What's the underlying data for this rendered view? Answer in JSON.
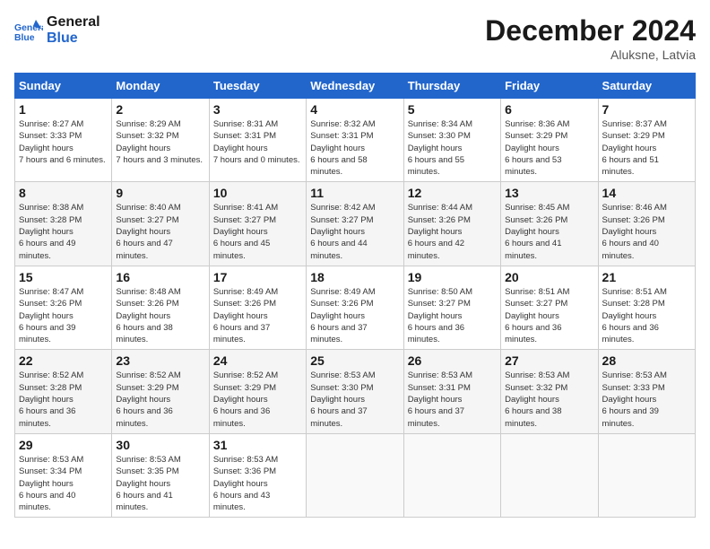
{
  "header": {
    "logo_line1": "General",
    "logo_line2": "Blue",
    "month": "December 2024",
    "location": "Aluksne, Latvia"
  },
  "days_of_week": [
    "Sunday",
    "Monday",
    "Tuesday",
    "Wednesday",
    "Thursday",
    "Friday",
    "Saturday"
  ],
  "weeks": [
    [
      {
        "day": 1,
        "sunrise": "8:27 AM",
        "sunset": "3:33 PM",
        "daylight": "7 hours and 6 minutes."
      },
      {
        "day": 2,
        "sunrise": "8:29 AM",
        "sunset": "3:32 PM",
        "daylight": "7 hours and 3 minutes."
      },
      {
        "day": 3,
        "sunrise": "8:31 AM",
        "sunset": "3:31 PM",
        "daylight": "7 hours and 0 minutes."
      },
      {
        "day": 4,
        "sunrise": "8:32 AM",
        "sunset": "3:31 PM",
        "daylight": "6 hours and 58 minutes."
      },
      {
        "day": 5,
        "sunrise": "8:34 AM",
        "sunset": "3:30 PM",
        "daylight": "6 hours and 55 minutes."
      },
      {
        "day": 6,
        "sunrise": "8:36 AM",
        "sunset": "3:29 PM",
        "daylight": "6 hours and 53 minutes."
      },
      {
        "day": 7,
        "sunrise": "8:37 AM",
        "sunset": "3:29 PM",
        "daylight": "6 hours and 51 minutes."
      }
    ],
    [
      {
        "day": 8,
        "sunrise": "8:38 AM",
        "sunset": "3:28 PM",
        "daylight": "6 hours and 49 minutes."
      },
      {
        "day": 9,
        "sunrise": "8:40 AM",
        "sunset": "3:27 PM",
        "daylight": "6 hours and 47 minutes."
      },
      {
        "day": 10,
        "sunrise": "8:41 AM",
        "sunset": "3:27 PM",
        "daylight": "6 hours and 45 minutes."
      },
      {
        "day": 11,
        "sunrise": "8:42 AM",
        "sunset": "3:27 PM",
        "daylight": "6 hours and 44 minutes."
      },
      {
        "day": 12,
        "sunrise": "8:44 AM",
        "sunset": "3:26 PM",
        "daylight": "6 hours and 42 minutes."
      },
      {
        "day": 13,
        "sunrise": "8:45 AM",
        "sunset": "3:26 PM",
        "daylight": "6 hours and 41 minutes."
      },
      {
        "day": 14,
        "sunrise": "8:46 AM",
        "sunset": "3:26 PM",
        "daylight": "6 hours and 40 minutes."
      }
    ],
    [
      {
        "day": 15,
        "sunrise": "8:47 AM",
        "sunset": "3:26 PM",
        "daylight": "6 hours and 39 minutes."
      },
      {
        "day": 16,
        "sunrise": "8:48 AM",
        "sunset": "3:26 PM",
        "daylight": "6 hours and 38 minutes."
      },
      {
        "day": 17,
        "sunrise": "8:49 AM",
        "sunset": "3:26 PM",
        "daylight": "6 hours and 37 minutes."
      },
      {
        "day": 18,
        "sunrise": "8:49 AM",
        "sunset": "3:26 PM",
        "daylight": "6 hours and 37 minutes."
      },
      {
        "day": 19,
        "sunrise": "8:50 AM",
        "sunset": "3:27 PM",
        "daylight": "6 hours and 36 minutes."
      },
      {
        "day": 20,
        "sunrise": "8:51 AM",
        "sunset": "3:27 PM",
        "daylight": "6 hours and 36 minutes."
      },
      {
        "day": 21,
        "sunrise": "8:51 AM",
        "sunset": "3:28 PM",
        "daylight": "6 hours and 36 minutes."
      }
    ],
    [
      {
        "day": 22,
        "sunrise": "8:52 AM",
        "sunset": "3:28 PM",
        "daylight": "6 hours and 36 minutes."
      },
      {
        "day": 23,
        "sunrise": "8:52 AM",
        "sunset": "3:29 PM",
        "daylight": "6 hours and 36 minutes."
      },
      {
        "day": 24,
        "sunrise": "8:52 AM",
        "sunset": "3:29 PM",
        "daylight": "6 hours and 36 minutes."
      },
      {
        "day": 25,
        "sunrise": "8:53 AM",
        "sunset": "3:30 PM",
        "daylight": "6 hours and 37 minutes."
      },
      {
        "day": 26,
        "sunrise": "8:53 AM",
        "sunset": "3:31 PM",
        "daylight": "6 hours and 37 minutes."
      },
      {
        "day": 27,
        "sunrise": "8:53 AM",
        "sunset": "3:32 PM",
        "daylight": "6 hours and 38 minutes."
      },
      {
        "day": 28,
        "sunrise": "8:53 AM",
        "sunset": "3:33 PM",
        "daylight": "6 hours and 39 minutes."
      }
    ],
    [
      {
        "day": 29,
        "sunrise": "8:53 AM",
        "sunset": "3:34 PM",
        "daylight": "6 hours and 40 minutes."
      },
      {
        "day": 30,
        "sunrise": "8:53 AM",
        "sunset": "3:35 PM",
        "daylight": "6 hours and 41 minutes."
      },
      {
        "day": 31,
        "sunrise": "8:53 AM",
        "sunset": "3:36 PM",
        "daylight": "6 hours and 43 minutes."
      },
      null,
      null,
      null,
      null
    ]
  ]
}
